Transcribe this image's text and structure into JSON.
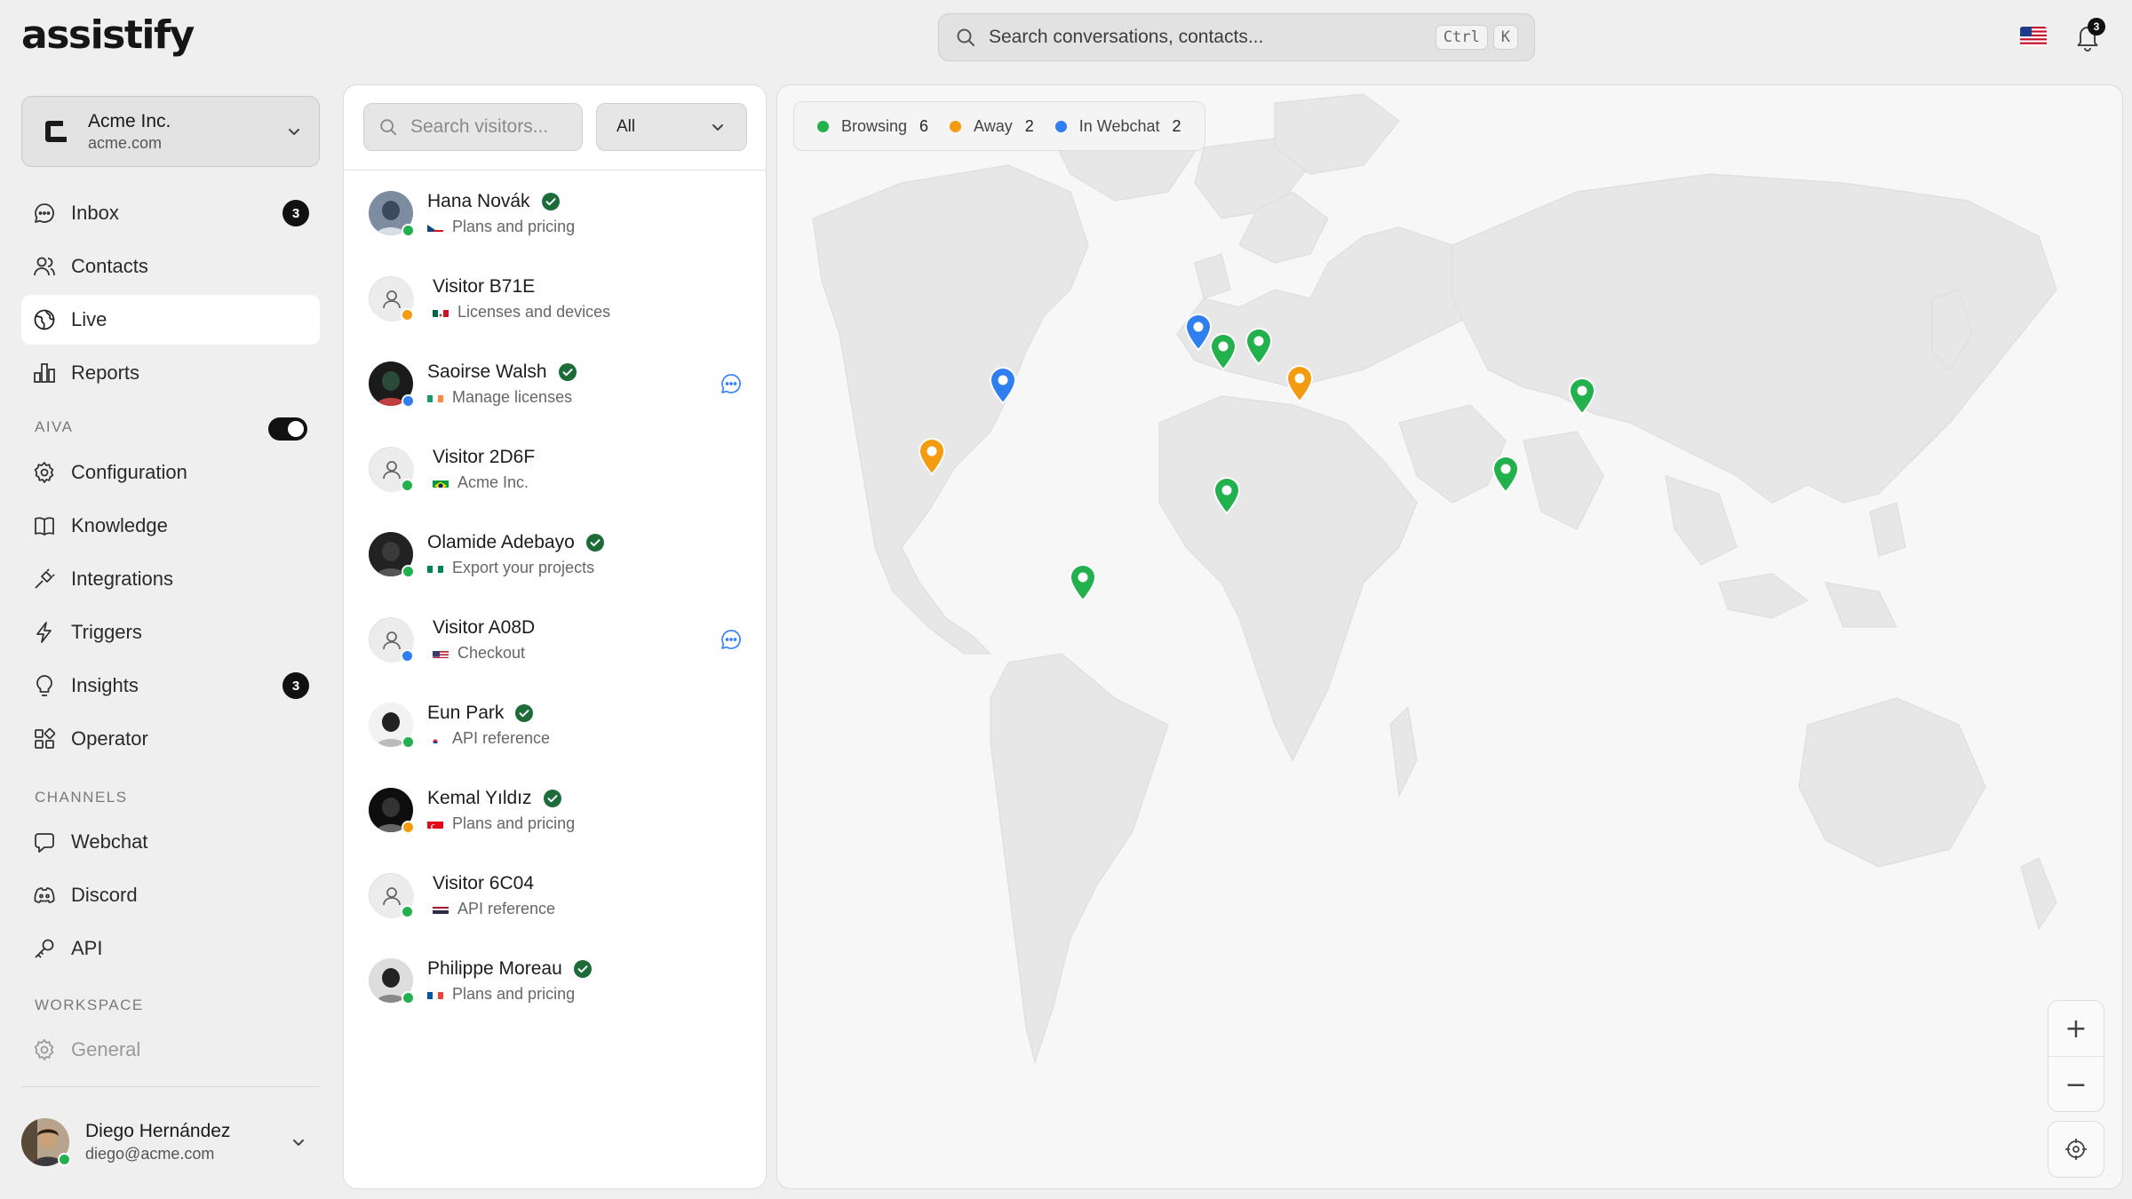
{
  "app": {
    "logo": "assistify"
  },
  "top_search": {
    "placeholder": "Search conversations, contacts...",
    "shortcut_ctrl": "Ctrl",
    "shortcut_key": "K"
  },
  "notifications": {
    "count": "3"
  },
  "org": {
    "name": "Acme Inc.",
    "domain": "acme.com"
  },
  "nav": {
    "inbox": {
      "label": "Inbox",
      "badge": "3"
    },
    "contacts": {
      "label": "Contacts"
    },
    "live": {
      "label": "Live"
    },
    "reports": {
      "label": "Reports"
    },
    "aiva_section": "AIVA",
    "configuration": {
      "label": "Configuration"
    },
    "knowledge": {
      "label": "Knowledge"
    },
    "integrations": {
      "label": "Integrations"
    },
    "triggers": {
      "label": "Triggers"
    },
    "insights": {
      "label": "Insights",
      "badge": "3"
    },
    "operator": {
      "label": "Operator"
    },
    "channels_section": "CHANNELS",
    "webchat": {
      "label": "Webchat"
    },
    "discord": {
      "label": "Discord"
    },
    "api": {
      "label": "API"
    },
    "workspace_section": "WORKSPACE",
    "general": {
      "label": "General"
    }
  },
  "user": {
    "name": "Diego Hernández",
    "email": "diego@acme.com"
  },
  "visitors_panel": {
    "search_placeholder": "Search visitors...",
    "filter_value": "All",
    "visitors": [
      {
        "name": "Hana Novák",
        "page": "Plans and pricing",
        "flag": "cz",
        "verified": true,
        "status": "browsing",
        "chat": false
      },
      {
        "name": "Visitor B71E",
        "page": "Licenses and devices",
        "flag": "mx",
        "verified": false,
        "status": "away",
        "chat": false
      },
      {
        "name": "Saoirse Walsh",
        "page": "Manage licenses",
        "flag": "ie",
        "verified": true,
        "status": "webchat",
        "chat": true
      },
      {
        "name": "Visitor 2D6F",
        "page": "Acme Inc.",
        "flag": "br",
        "verified": false,
        "status": "browsing",
        "chat": false
      },
      {
        "name": "Olamide Adebayo",
        "page": "Export your projects",
        "flag": "ng",
        "verified": true,
        "status": "browsing",
        "chat": false
      },
      {
        "name": "Visitor A08D",
        "page": "Checkout",
        "flag": "us",
        "verified": false,
        "status": "webchat",
        "chat": true
      },
      {
        "name": "Eun Park",
        "page": "API reference",
        "flag": "kr",
        "verified": true,
        "status": "browsing",
        "chat": false
      },
      {
        "name": "Kemal Yıldız",
        "page": "Plans and pricing",
        "flag": "tr",
        "verified": true,
        "status": "away",
        "chat": false
      },
      {
        "name": "Visitor 6C04",
        "page": "API reference",
        "flag": "th",
        "verified": false,
        "status": "browsing",
        "chat": false
      },
      {
        "name": "Philippe Moreau",
        "page": "Plans and pricing",
        "flag": "fr",
        "verified": true,
        "status": "browsing",
        "chat": false
      }
    ]
  },
  "map": {
    "legend": [
      {
        "label": "Browsing",
        "count": "6",
        "color": "#22b14c"
      },
      {
        "label": "Away",
        "count": "2",
        "color": "#f39c12"
      },
      {
        "label": "In Webchat",
        "count": "2",
        "color": "#2f7ff0"
      }
    ],
    "pins": [
      {
        "country": "ie",
        "status": "webchat"
      },
      {
        "country": "fr",
        "status": "browsing"
      },
      {
        "country": "cz",
        "status": "browsing"
      },
      {
        "country": "tr",
        "status": "away"
      },
      {
        "country": "kr",
        "status": "browsing"
      },
      {
        "country": "us",
        "status": "webchat"
      },
      {
        "country": "mx",
        "status": "away"
      },
      {
        "country": "ng",
        "status": "browsing"
      },
      {
        "country": "th",
        "status": "browsing"
      },
      {
        "country": "br",
        "status": "browsing"
      }
    ],
    "zoom_in": "+",
    "zoom_out": "−"
  },
  "colors": {
    "browsing": "#22b14c",
    "away": "#f39c12",
    "webchat": "#2f7ff0",
    "verified": "#1e6b3a",
    "chat_icon": "#3b82f6"
  },
  "icons": {
    "inbox": "chat-bubble-icon",
    "contacts": "users-icon",
    "live": "globe-icon",
    "reports": "bar-chart-icon",
    "configuration": "gear-icon",
    "knowledge": "book-icon",
    "integrations": "plug-icon",
    "triggers": "lightning-icon",
    "insights": "bulb-icon",
    "operator": "grid-icon",
    "webchat": "chat-icon",
    "discord": "discord-icon",
    "api": "key-icon",
    "general": "gear-icon"
  }
}
